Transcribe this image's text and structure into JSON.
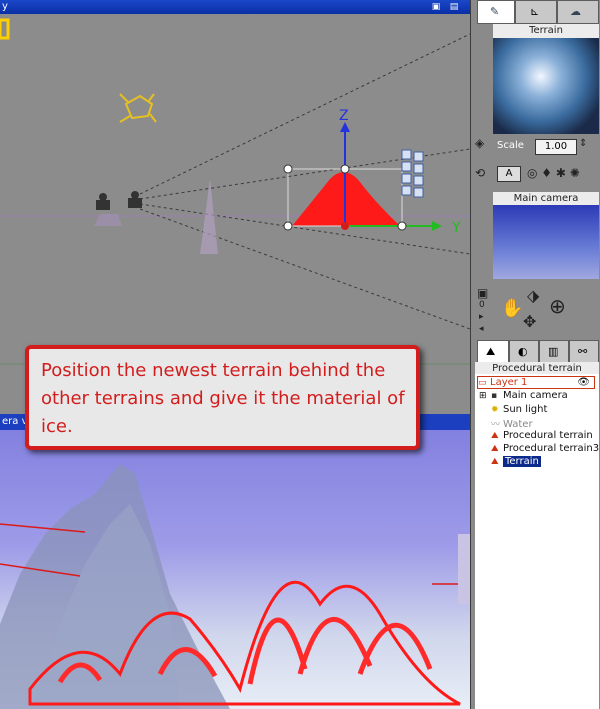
{
  "window": {
    "title": "y"
  },
  "callout": {
    "text": "Position the newest terrain behind the other terrains and give it the material of ice."
  },
  "top_view": {
    "axes": {
      "x": "Y",
      "z": "Z"
    }
  },
  "bottom_view": {
    "title": "era v"
  },
  "right_panel": {
    "material_section": {
      "title": "Terrain",
      "scale_label": "Scale",
      "scale_value": "1.00"
    },
    "camera_section": {
      "title": "Main camera"
    },
    "tree_section": {
      "title": "Procedural terrain",
      "items": [
        {
          "label": "Layer 1"
        },
        {
          "label": "Main camera"
        },
        {
          "label": "Sun light"
        },
        {
          "label": "Water"
        },
        {
          "label": "Procedural terrain"
        },
        {
          "label": "Procedural terrain3"
        },
        {
          "label": "Terrain"
        }
      ]
    },
    "view_button_letter": "A",
    "counter": "0"
  },
  "colors": {
    "accent": "#d31d1d",
    "axis_x": "#22bb22",
    "axis_z": "#2233dd",
    "terrain": "#ff1a1a"
  }
}
